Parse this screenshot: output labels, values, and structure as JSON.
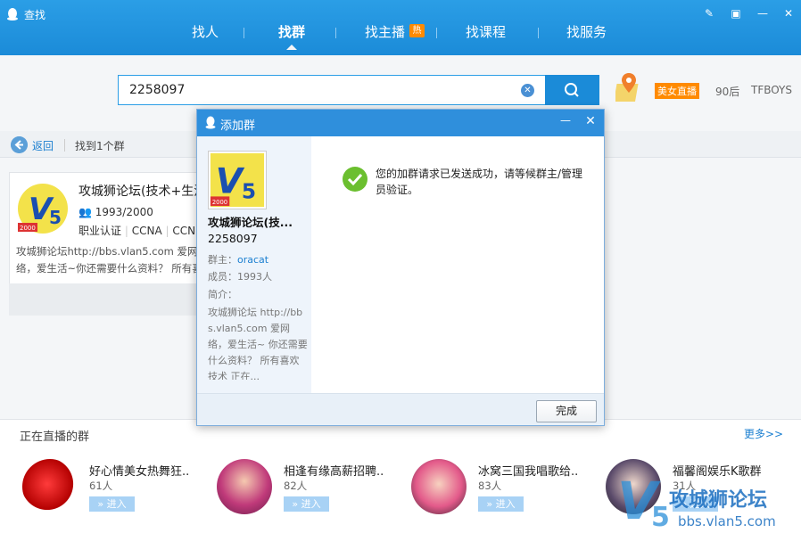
{
  "window": {
    "title": "查找"
  },
  "nav": {
    "tabs": [
      {
        "label": "找人"
      },
      {
        "label": "找群"
      },
      {
        "label": "找主播"
      },
      {
        "label": "找课程"
      },
      {
        "label": "找服务"
      }
    ],
    "active": "找群",
    "hot_badge": "热"
  },
  "search": {
    "value": "2258097",
    "live_badge": "美女直播",
    "tags": [
      "90后",
      "TFBOYS"
    ]
  },
  "results": {
    "back_label": "返回",
    "count_text": "找到1个群"
  },
  "group_card": {
    "name": "攻城狮论坛(技术+生活)",
    "members": "1993/2000",
    "tags": [
      "职业认证",
      "CCNA",
      "CCNP"
    ],
    "desc": "攻城狮论坛http://bbs.vlan5.com 爱网络，爱生活~你还需要什么资料？ 所有喜欢技术 正在..."
  },
  "dialog": {
    "title": "添加群",
    "group_name": "攻城狮论坛(技...",
    "group_id": "2258097",
    "owner_label": "群主：",
    "owner_name": "oracat",
    "members_text": "成员：1993人",
    "intro_label": "简介：",
    "intro_text": "攻城狮论坛 http://bbs.vlan5.com 爱网络，爱生活~ 你还需要什么资料？ 所有喜欢技术 正在...",
    "success_message": "您的加群请求已发送成功，请等候群主/管理员验证。",
    "done_label": "完成"
  },
  "live_groups": {
    "title": "正在直播的群",
    "more_label": "更多>>",
    "enter_label": "» 进入",
    "items": [
      {
        "name": "好心情美女热舞狂..",
        "count": "61人"
      },
      {
        "name": "相逢有缘高薪招聘..",
        "count": "82人"
      },
      {
        "name": "冰窝三国我唱歌给..",
        "count": "83人"
      },
      {
        "name": "福馨阁娱乐K歌群",
        "count": "31人"
      }
    ]
  },
  "watermark": {
    "text": "攻城狮论坛",
    "url": "bbs.vlan5.com"
  },
  "colors": {
    "primary": "#1b8bd8",
    "accent": "#ff8a00",
    "link": "#1b7fd0"
  }
}
